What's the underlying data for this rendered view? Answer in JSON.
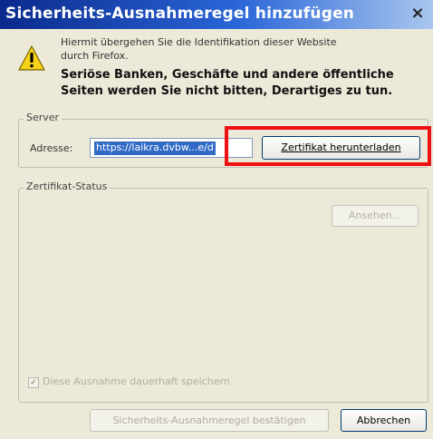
{
  "dialog": {
    "title": "Sicherheits-Ausnahmeregel hinzufügen",
    "close_glyph": "×"
  },
  "message": {
    "line1": "Hiermit übergehen Sie die Identifikation dieser Website",
    "line2": "durch Firefox.",
    "bold_line1": "Seriöse Banken, Geschäfte und andere öffentliche",
    "bold_line2": "Seiten werden Sie nicht bitten, Derartiges zu tun."
  },
  "server": {
    "group_label": "Server",
    "address_label": "Adresse:",
    "address_value": "https://laikra.dvbw...e/d",
    "download_button": "Zertifikat herunterladen"
  },
  "status": {
    "group_label": "Zertifikat-Status",
    "view_button": "Ansehen..."
  },
  "permanent": {
    "label": "Diese Ausnahme dauerhaft speichern",
    "checked": true,
    "check_glyph": "✔"
  },
  "footer": {
    "confirm_button": "Sicherheits-Ausnahmeregel bestätigen",
    "cancel_button": "Abbrechen"
  },
  "colors": {
    "titlebar_start": "#0a2a8c",
    "highlight": "#ee1111",
    "selection": "#316ac5"
  },
  "icons": {
    "warning": "warning-icon",
    "close": "close-icon"
  }
}
